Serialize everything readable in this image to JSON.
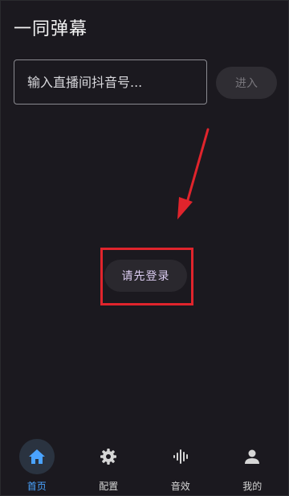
{
  "header": {
    "title": "一同弹幕"
  },
  "room_input": {
    "placeholder": "输入直播间抖音号..."
  },
  "enter_button": {
    "label": "进入"
  },
  "login_button": {
    "label": "请先登录"
  },
  "annotation": {
    "color": "#e0242c"
  },
  "bottom_nav": {
    "items": [
      {
        "label": "首页",
        "icon": "home-icon",
        "active": true
      },
      {
        "label": "配置",
        "icon": "gear-icon",
        "active": false
      },
      {
        "label": "音效",
        "icon": "sound-wave-icon",
        "active": false
      },
      {
        "label": "我的",
        "icon": "person-icon",
        "active": false
      }
    ]
  },
  "colors": {
    "background": "#1b191f",
    "accent": "#4aa3ff"
  }
}
